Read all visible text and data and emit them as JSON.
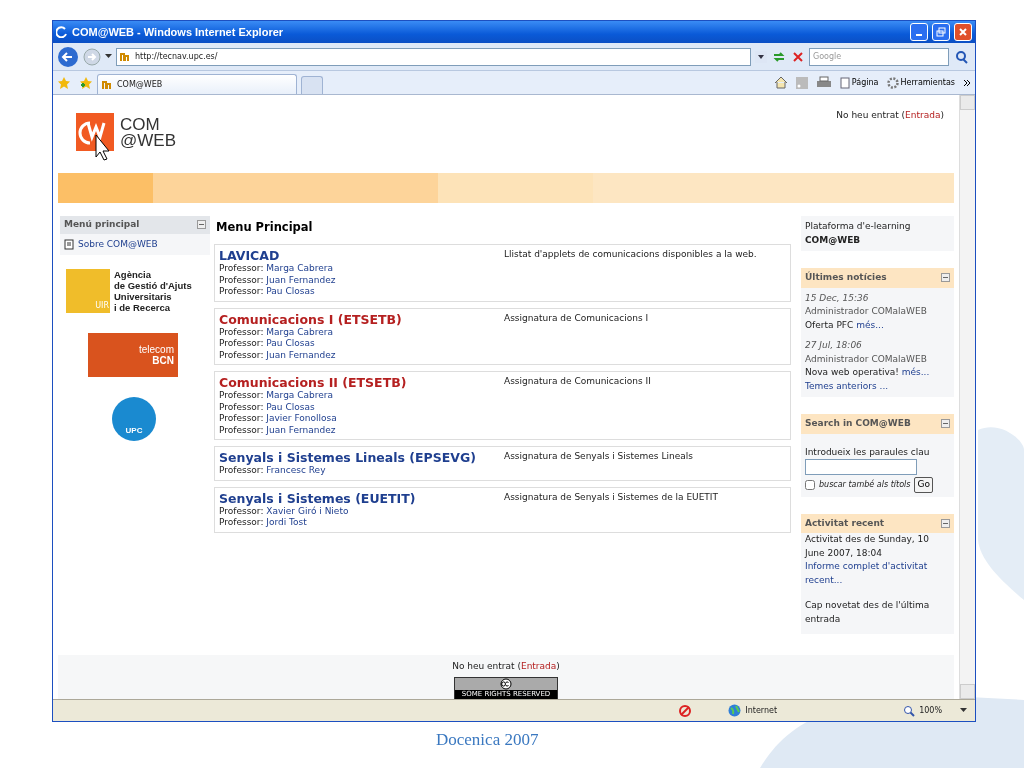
{
  "window": {
    "title": "COM@WEB - Windows Internet Explorer"
  },
  "address_bar": {
    "url": "http://tecnav.upc.es/"
  },
  "search_field": {
    "placeholder": "Google"
  },
  "tabs": [
    {
      "label": "COM@WEB",
      "selected": true
    }
  ],
  "command_bar": [
    {
      "label": "Página",
      "kind": "page"
    },
    {
      "label": "Herramientas",
      "kind": "tools"
    }
  ],
  "header": {
    "logo": [
      "COM",
      "@WEB"
    ],
    "login": {
      "text": "No heu entrat (",
      "link": "Entrada",
      "after": ")"
    }
  },
  "left_menu": {
    "title": "Menú principal",
    "items": [
      "Sobre COM@WEB"
    ]
  },
  "sponsors": {
    "agaur": {
      "mark": "UIR",
      "lines": [
        "Agència",
        "de Gestió d'Ajuts",
        "Universitaris",
        "i de Recerca"
      ]
    },
    "telecom": [
      "telecom",
      "BCN"
    ],
    "upc": "UPC"
  },
  "main": {
    "title": "Menu Principal",
    "courses": [
      {
        "title": "LAVICAD",
        "visited": false,
        "description": "Llistat d'applets de comunicacions disponibles a la web.",
        "professors": [
          {
            "label": "Professor:",
            "name": "Marga Cabrera"
          },
          {
            "label": "Professor:",
            "name": "Juan Fernandez"
          },
          {
            "label": "Professor:",
            "name": "Pau Closas"
          }
        ]
      },
      {
        "title": "Comunicacions I (ETSETB)",
        "visited": true,
        "description": "Assignatura de Comunicacions I",
        "professors": [
          {
            "label": "Professor:",
            "name": "Marga Cabrera"
          },
          {
            "label": "Professor:",
            "name": "Pau Closas"
          },
          {
            "label": "Professor:",
            "name": "Juan Fernandez"
          }
        ]
      },
      {
        "title": "Comunicacions II (ETSETB)",
        "visited": true,
        "description": "Assignatura de Comunicacions II",
        "professors": [
          {
            "label": "Professor:",
            "name": "Marga Cabrera"
          },
          {
            "label": "Professor:",
            "name": "Pau Closas"
          },
          {
            "label": "Professor:",
            "name": "Javier Fonollosa"
          },
          {
            "label": "Professor:",
            "name": "Juan Fernandez"
          }
        ]
      },
      {
        "title": "Senyals i Sistemes Lineals (EPSEVG)",
        "visited": false,
        "description": "Assignatura de Senyals i Sistemes Lineals",
        "professors": [
          {
            "label": "Professor:",
            "name": "Francesc Rey"
          }
        ]
      },
      {
        "title": "Senyals i Sistemes (EUETIT)",
        "visited": false,
        "description": "Assignatura de Senyals i Sistemes de la EUETIT",
        "professors": [
          {
            "label": "Professor:",
            "name": "Xavier Giró i Nieto"
          },
          {
            "label": "Professor:",
            "name": "Jordi Tost"
          }
        ]
      }
    ]
  },
  "right": {
    "platform": [
      "Plataforma d'e-learning",
      "COM@WEB"
    ],
    "news": {
      "title": "Últimes notícies",
      "items": [
        {
          "date": "15 Dec, 15:36",
          "author": "Administrador COMalaWEB",
          "text": "Oferta PFC",
          "link": "més..."
        },
        {
          "date": "27 Jul, 18:06",
          "author": "Administrador COMalaWEB",
          "text": "Nova web operativa!",
          "link": "més..."
        }
      ],
      "more": "Temes anteriors ..."
    },
    "search": {
      "title": "Search in COM@WEB",
      "label": "Introdueix les paraules clau",
      "checkbox": {
        "label": "buscar també als títols",
        "checked": false
      },
      "button": "Go"
    },
    "activity": {
      "title": "Activitat recent",
      "since": "Activitat des de Sunday, 10 June 2007, 18:04",
      "link": "Informe complet d'activitat recent...",
      "note": "Cap novetat des de l'última entrada"
    }
  },
  "footer": {
    "login": {
      "text": "No heu entrat (",
      "link": "Entrada",
      "after": ")"
    },
    "license": "SOME RIGHTS RESERVED"
  },
  "status_bar": {
    "zone": "Internet",
    "zoom": "100%"
  },
  "slide": {
    "caption": "Docenica 2007"
  }
}
